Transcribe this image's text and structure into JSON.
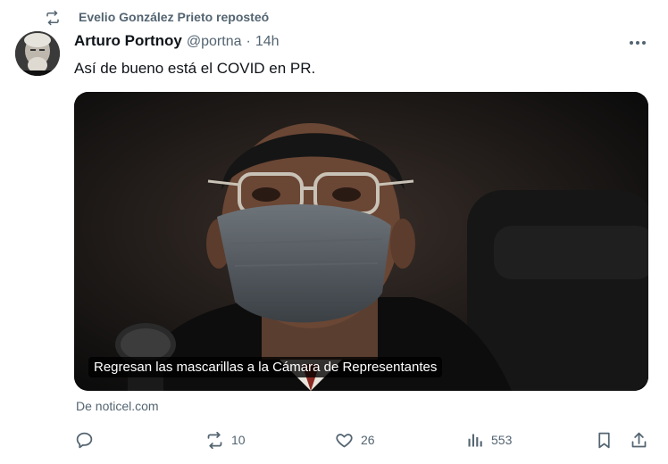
{
  "repost": {
    "icon": "repost-icon",
    "text": "Evelio González Prieto reposteó"
  },
  "tweet": {
    "author_name": "Arturo Portnoy",
    "handle": "@portna",
    "separator": "·",
    "time": "14h",
    "text": "Así de bueno está el COVID en PR.",
    "more_icon": "more-horizontal-icon"
  },
  "card": {
    "caption": "Regresan las mascarillas a la Cámara de Representantes",
    "source": "De noticel.com"
  },
  "actions": {
    "reply": {
      "icon": "reply-icon",
      "count": ""
    },
    "repost": {
      "icon": "repost-icon",
      "count": "10"
    },
    "like": {
      "icon": "heart-icon",
      "count": "26"
    },
    "views": {
      "icon": "views-bar-chart-icon",
      "count": "553"
    },
    "bookmark": {
      "icon": "bookmark-icon"
    },
    "share": {
      "icon": "share-icon"
    }
  },
  "colors": {
    "text_primary": "#0f1419",
    "text_secondary": "#536471",
    "background": "#ffffff"
  }
}
